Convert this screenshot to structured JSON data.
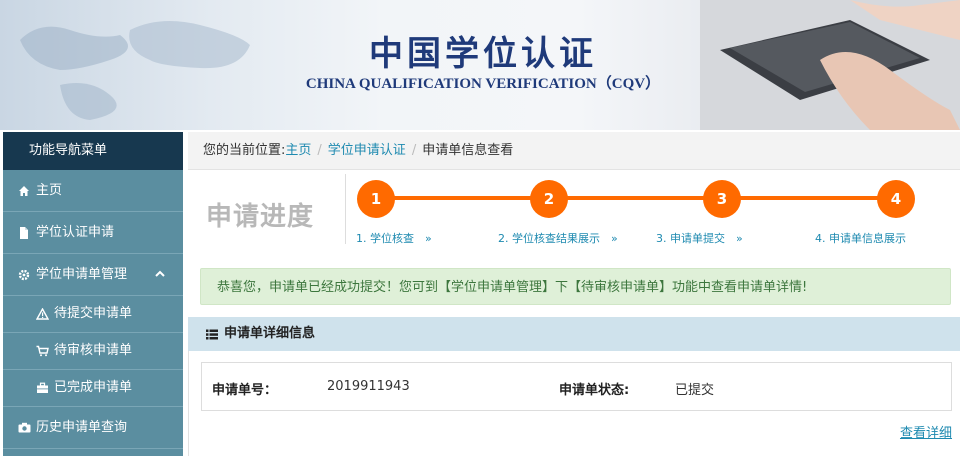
{
  "banner": {
    "title_cn": "中国学位认证",
    "title_en": "CHINA QUALIFICATION VERIFICATION（CQV）"
  },
  "sidebar": {
    "header": "功能导航菜单",
    "items": [
      {
        "label": "主页",
        "icon": "home-icon"
      },
      {
        "label": "学位认证申请",
        "icon": "file-icon"
      },
      {
        "label": "学位申请单管理",
        "icon": "gear-icon",
        "expanded": true
      },
      {
        "label": "待提交申请单",
        "icon": "warning-icon"
      },
      {
        "label": "待审核申请单",
        "icon": "cart-icon"
      },
      {
        "label": "已完成申请单",
        "icon": "briefcase-icon"
      },
      {
        "label": "历史申请单查询",
        "icon": "camera-icon"
      }
    ]
  },
  "breadcrumb": {
    "prefix": "您的当前位置:",
    "home": "主页",
    "section": "学位申请认证",
    "current": "申请单信息查看"
  },
  "progress": {
    "title": "申请进度",
    "steps": [
      {
        "num": "1",
        "label": "1. 学位核查　»"
      },
      {
        "num": "2",
        "label": "2. 学位核查结果展示　»"
      },
      {
        "num": "3",
        "label": "3. 申请单提交　»"
      },
      {
        "num": "4",
        "label": "4. 申请单信息展示"
      }
    ]
  },
  "alert": {
    "text": "恭喜您，申请单已经成功提交！您可到【学位申请单管理】下【待审核申请单】功能中查看申请单详情!"
  },
  "detail": {
    "title": "申请单详细信息",
    "number_label": "申请单号：",
    "number_value": "2019911943",
    "status_label": "申请单状态:",
    "status_value": "已提交",
    "more_link": "查看详细"
  },
  "colors": {
    "accent_orange": "#ff6a00",
    "sidebar_bg": "#5b8ea0",
    "sidebar_head": "#17384f",
    "link_blue": "#1e8ab0",
    "alert_bg": "#dff0d8",
    "panel_head_bg": "#cfe2ec"
  }
}
